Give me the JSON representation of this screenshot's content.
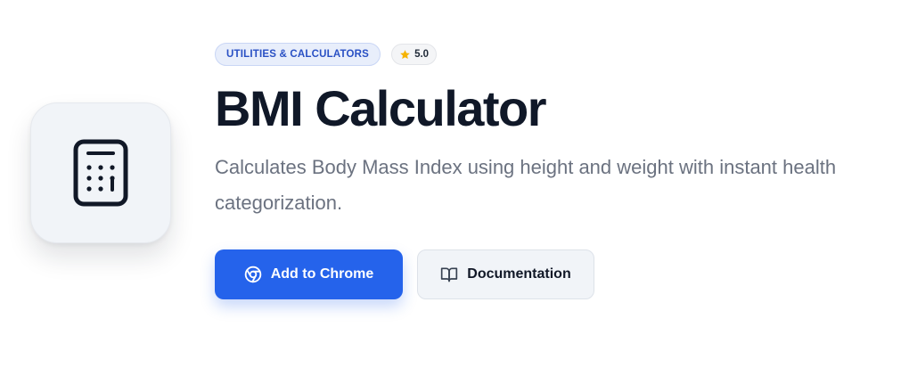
{
  "app": {
    "icon": "calculator-icon",
    "category": "UTILITIES & CALCULATORS",
    "rating": "5.0",
    "title": "BMI Calculator",
    "description": "Calculates Body Mass Index using height and weight with instant health categorization."
  },
  "actions": {
    "primary_label": "Add to Chrome",
    "primary_icon": "chrome-icon",
    "secondary_label": "Documentation",
    "secondary_icon": "book-icon"
  },
  "colors": {
    "accent": "#2563eb",
    "star": "#f5b301",
    "title": "#101828",
    "muted_text": "#6b7280"
  }
}
